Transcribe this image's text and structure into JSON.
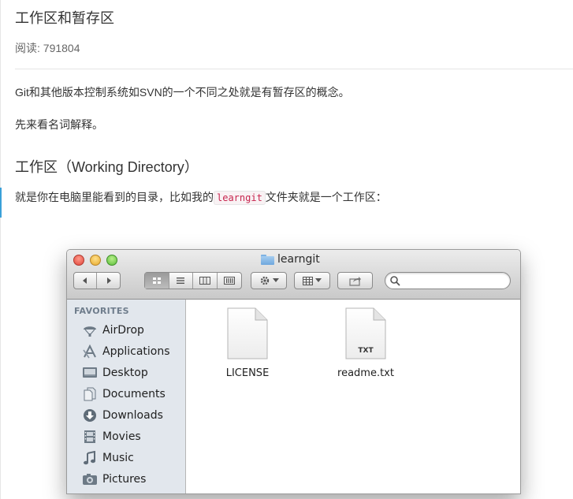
{
  "article": {
    "title": "工作区和暂存区",
    "read_count": "阅读: 791804",
    "para1": "Git和其他版本控制系统如SVN的一个不同之处就是有暂存区的概念。",
    "para2": "先来看名词解释。",
    "section_heading": "工作区（Working Directory）",
    "para3_before": "就是你在电脑里能看到的目录，比如我的",
    "para3_code": "learngit",
    "para3_after": "文件夹就是一个工作区："
  },
  "finder": {
    "window_title": "learngit",
    "sidebar": {
      "header": "FAVORITES",
      "items": [
        {
          "label": "AirDrop",
          "icon": "airdrop-icon"
        },
        {
          "label": "Applications",
          "icon": "applications-icon"
        },
        {
          "label": "Desktop",
          "icon": "desktop-icon"
        },
        {
          "label": "Documents",
          "icon": "documents-icon"
        },
        {
          "label": "Downloads",
          "icon": "downloads-icon"
        },
        {
          "label": "Movies",
          "icon": "movies-icon"
        },
        {
          "label": "Music",
          "icon": "music-icon"
        },
        {
          "label": "Pictures",
          "icon": "pictures-icon"
        }
      ]
    },
    "files": [
      {
        "name": "LICENSE",
        "icon": "document-icon"
      },
      {
        "name": "readme.txt",
        "icon": "txt-file-icon",
        "badge": "TXT"
      }
    ]
  },
  "colors": {
    "code_text": "#c7254e",
    "code_bg": "#f9f2f4",
    "sidebar_bg": "#e2e7ed",
    "accent": "#3aa0d8"
  }
}
